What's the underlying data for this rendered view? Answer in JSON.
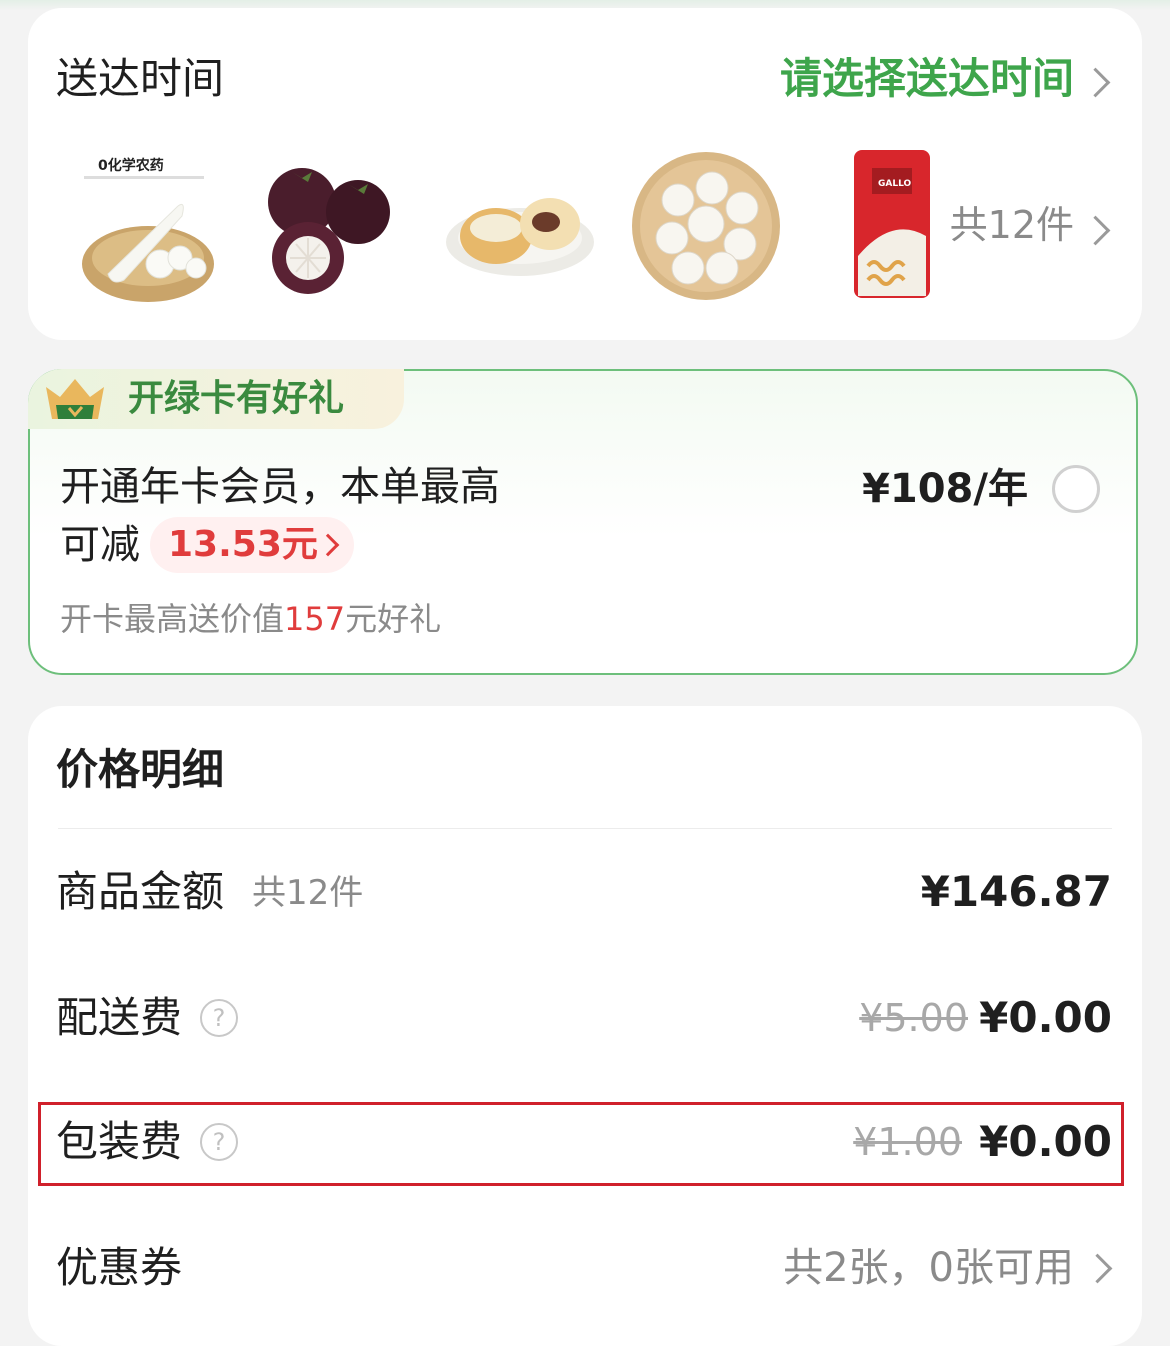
{
  "delivery": {
    "label": "送达时间",
    "choose_text": "请选择送达时间",
    "items": [
      {
        "name": "daikon-radish",
        "badge": "0化学农药"
      },
      {
        "name": "mangosteen"
      },
      {
        "name": "custard-bun"
      },
      {
        "name": "white-mushrooms"
      },
      {
        "name": "gallo-pasta",
        "brand": "GALLO"
      }
    ],
    "count_text": "共12件"
  },
  "member": {
    "tag": "开绿卡有好礼",
    "line1": "开通年卡会员，本单最高",
    "line2_prefix": "可减",
    "save_amount": "13.53元",
    "price": "¥108/年",
    "gift_prefix": "开卡最高送价值",
    "gift_amount": "157",
    "gift_suffix": "元好礼"
  },
  "pricing": {
    "title": "价格明细",
    "goods": {
      "label": "商品金额",
      "sub": "共12件",
      "value": "¥146.87"
    },
    "shipping": {
      "label": "配送费",
      "original": "¥5.00",
      "value": "¥0.00"
    },
    "packaging": {
      "label": "包装费",
      "original": "¥1.00",
      "value": "¥0.00"
    },
    "coupon": {
      "label": "优惠券",
      "value": "共2张，0张可用"
    }
  },
  "colors": {
    "accent_green": "#3ea54b",
    "price_red": "#e03c3c",
    "highlight_red": "#d0202b"
  }
}
